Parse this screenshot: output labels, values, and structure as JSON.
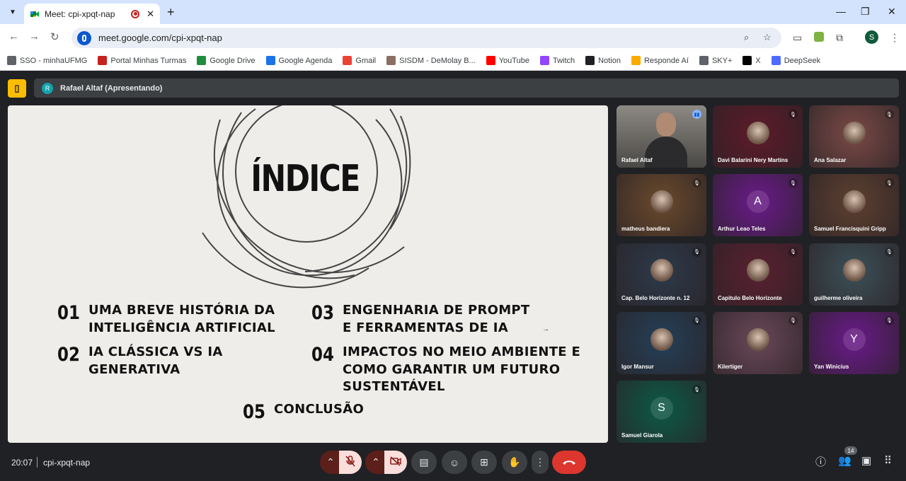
{
  "browser": {
    "tab_title": "Meet: cpi-xpqt-nap",
    "tab_close": "✕",
    "new_tab": "+",
    "url": "meet.google.com/cpi-xpqt-nap",
    "profile_initial": "S"
  },
  "bookmarks": [
    {
      "label": "SSO - minhaUFMG",
      "icon": "globe-icon",
      "color": "#5f6368"
    },
    {
      "label": "Portal Minhas Turmas",
      "icon": "ufmg-icon",
      "color": "#c5221f"
    },
    {
      "label": "Google Drive",
      "icon": "drive-icon",
      "color": "#1e8e3e"
    },
    {
      "label": "Google Agenda",
      "icon": "calendar-icon",
      "color": "#1a73e8"
    },
    {
      "label": "Gmail",
      "icon": "gmail-icon",
      "color": "#ea4335"
    },
    {
      "label": "SISDM - DeMolay B...",
      "icon": "sisdm-icon",
      "color": "#8d6e63"
    },
    {
      "label": "YouTube",
      "icon": "youtube-icon",
      "color": "#ff0000"
    },
    {
      "label": "Twitch",
      "icon": "twitch-icon",
      "color": "#9146ff"
    },
    {
      "label": "Notion",
      "icon": "notion-icon",
      "color": "#202124"
    },
    {
      "label": "Responde Aí",
      "icon": "responde-icon",
      "color": "#f9ab00"
    },
    {
      "label": "SKY+",
      "icon": "globe-icon",
      "color": "#5f6368"
    },
    {
      "label": "X",
      "icon": "x-icon",
      "color": "#000000"
    },
    {
      "label": "DeepSeek",
      "icon": "deepseek-icon",
      "color": "#4d6bfe"
    }
  ],
  "meet": {
    "presenter_initial": "R",
    "presenter_label": "Rafael Altaf (Apresentando)",
    "time": "20:07",
    "code": "cpi-xpqt-nap",
    "people_count": "14"
  },
  "slide": {
    "title": "ÍNDICE",
    "items": [
      {
        "num": "01",
        "text": "UMA BREVE HISTÓRIA DA\nINTELIGÊNCIA ARTIFICIAL"
      },
      {
        "num": "02",
        "text": "IA CLÁSSICA VS IA\nGENERATIVA"
      },
      {
        "num": "03",
        "text": "ENGENHARIA DE PROMPT\nE FERRAMENTAS DE IA"
      },
      {
        "num": "04",
        "text": "IMPACTOS NO MEIO AMBIENTE E\nCOMO GARANTIR UM FUTURO\nSUSTENTÁVEL"
      },
      {
        "num": "05",
        "text": "CONCLUSÃO"
      }
    ],
    "arrow": "→"
  },
  "participants": [
    {
      "name": "Rafael Altaf",
      "kind": "video",
      "bg": "#6b6a66",
      "active": true
    },
    {
      "name": "Davi Balarini Nery Martins",
      "kind": "photo",
      "bg": "#5e1a2a",
      "muted": true
    },
    {
      "name": "Ana Salazar",
      "kind": "photo",
      "bg": "#7a4a46",
      "muted": true
    },
    {
      "name": "matheus bandiera",
      "kind": "photo",
      "bg": "#6a4a2c",
      "muted": true
    },
    {
      "name": "Arthur Leao Teles",
      "kind": "letter",
      "initial": "A",
      "bg": "#6a1a8a",
      "muted": true
    },
    {
      "name": "Samuel Francisquini Gripp",
      "kind": "photo",
      "bg": "#5e4030",
      "muted": true
    },
    {
      "name": "Cap. Belo Horizonte n. 12",
      "kind": "logo",
      "bg": "#2c3a4a",
      "muted": true
    },
    {
      "name": "Capitulo Belo Horizonte",
      "kind": "logo",
      "bg": "#5a2030",
      "muted": true
    },
    {
      "name": "guilherme oliveira",
      "kind": "photo",
      "bg": "#3c5058",
      "muted": true
    },
    {
      "name": "Igor Mansur",
      "kind": "photo",
      "bg": "#244058",
      "muted": true
    },
    {
      "name": "Kilertiger",
      "kind": "photo",
      "bg": "#6a4858",
      "muted": true
    },
    {
      "name": "Yan Winicius",
      "kind": "letter",
      "initial": "Y",
      "bg": "#6a1a8a",
      "muted": true
    },
    {
      "name": "Samuel Giarola",
      "kind": "letter",
      "initial": "S",
      "bg": "#0c5a46",
      "muted": true
    }
  ]
}
